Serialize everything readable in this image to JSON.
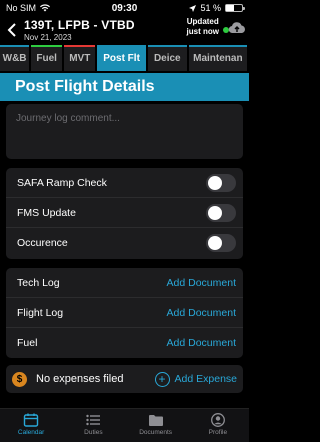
{
  "status_bar": {
    "carrier": "No SIM",
    "time": "09:30",
    "battery": "51 %",
    "battery_level": 0.51
  },
  "header": {
    "title": "139T, LFPB - VTBD",
    "date": "Nov 21, 2023",
    "update_line1": "Updated",
    "update_line2": "just now",
    "sync_color": "#2ecc40"
  },
  "tabs": [
    {
      "label": "W&B",
      "active": false,
      "bar_color": "#1a8fb5"
    },
    {
      "label": "Fuel",
      "active": false,
      "bar_color": "#2ecc40"
    },
    {
      "label": "MVT",
      "active": false,
      "bar_color": "#e53935"
    },
    {
      "label": "Post Flt",
      "active": true,
      "bar_color": "#1a8fb5"
    },
    {
      "label": "Deice",
      "active": false,
      "bar_color": "#1a8fb5"
    },
    {
      "label": "Maintenan",
      "active": false,
      "bar_color": "#1a8fb5"
    }
  ],
  "page_title": "Post Flight Details",
  "comment": {
    "placeholder": "Journey log comment..."
  },
  "toggles": [
    {
      "label": "SAFA Ramp Check",
      "on": false
    },
    {
      "label": "FMS Update",
      "on": false
    },
    {
      "label": "Occurence",
      "on": false
    }
  ],
  "documents": [
    {
      "label": "Tech Log",
      "action": "Add Document"
    },
    {
      "label": "Flight Log",
      "action": "Add Document"
    },
    {
      "label": "Fuel",
      "action": "Add Document"
    }
  ],
  "expenses": {
    "icon_text": "$",
    "status": "No expenses filed",
    "add_label": "Add Expense"
  },
  "bottom_nav": [
    {
      "label": "Calendar",
      "icon": "calendar-icon",
      "active": true
    },
    {
      "label": "Duties",
      "icon": "list-icon",
      "active": false
    },
    {
      "label": "Documents",
      "icon": "folder-icon",
      "active": false
    },
    {
      "label": "Profile",
      "icon": "profile-icon",
      "active": false
    }
  ],
  "colors": {
    "accent": "#1a8fb5",
    "link": "#29a8d8",
    "expense_icon": "#d9861f"
  }
}
